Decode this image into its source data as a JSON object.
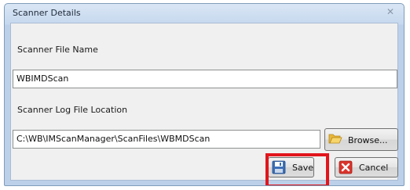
{
  "window": {
    "title": "Scanner Details",
    "close_icon": "close-icon"
  },
  "form": {
    "scanner_file_name_label": "Scanner File Name",
    "scanner_file_name_value": "WBIMDScan",
    "log_location_label": "Scanner Log File Location",
    "log_location_value": "C:\\WB\\IMScanManager\\ScanFiles\\WBMDScan"
  },
  "buttons": {
    "browse_label": "Browse...",
    "browse_icon": "folder-open-icon",
    "save_label": "Save",
    "save_icon": "floppy-disk-icon",
    "cancel_label": "Cancel",
    "cancel_icon": "red-x-icon"
  },
  "annotation": {
    "highlight_color": "#e2151c",
    "highlighted": "save-button"
  }
}
